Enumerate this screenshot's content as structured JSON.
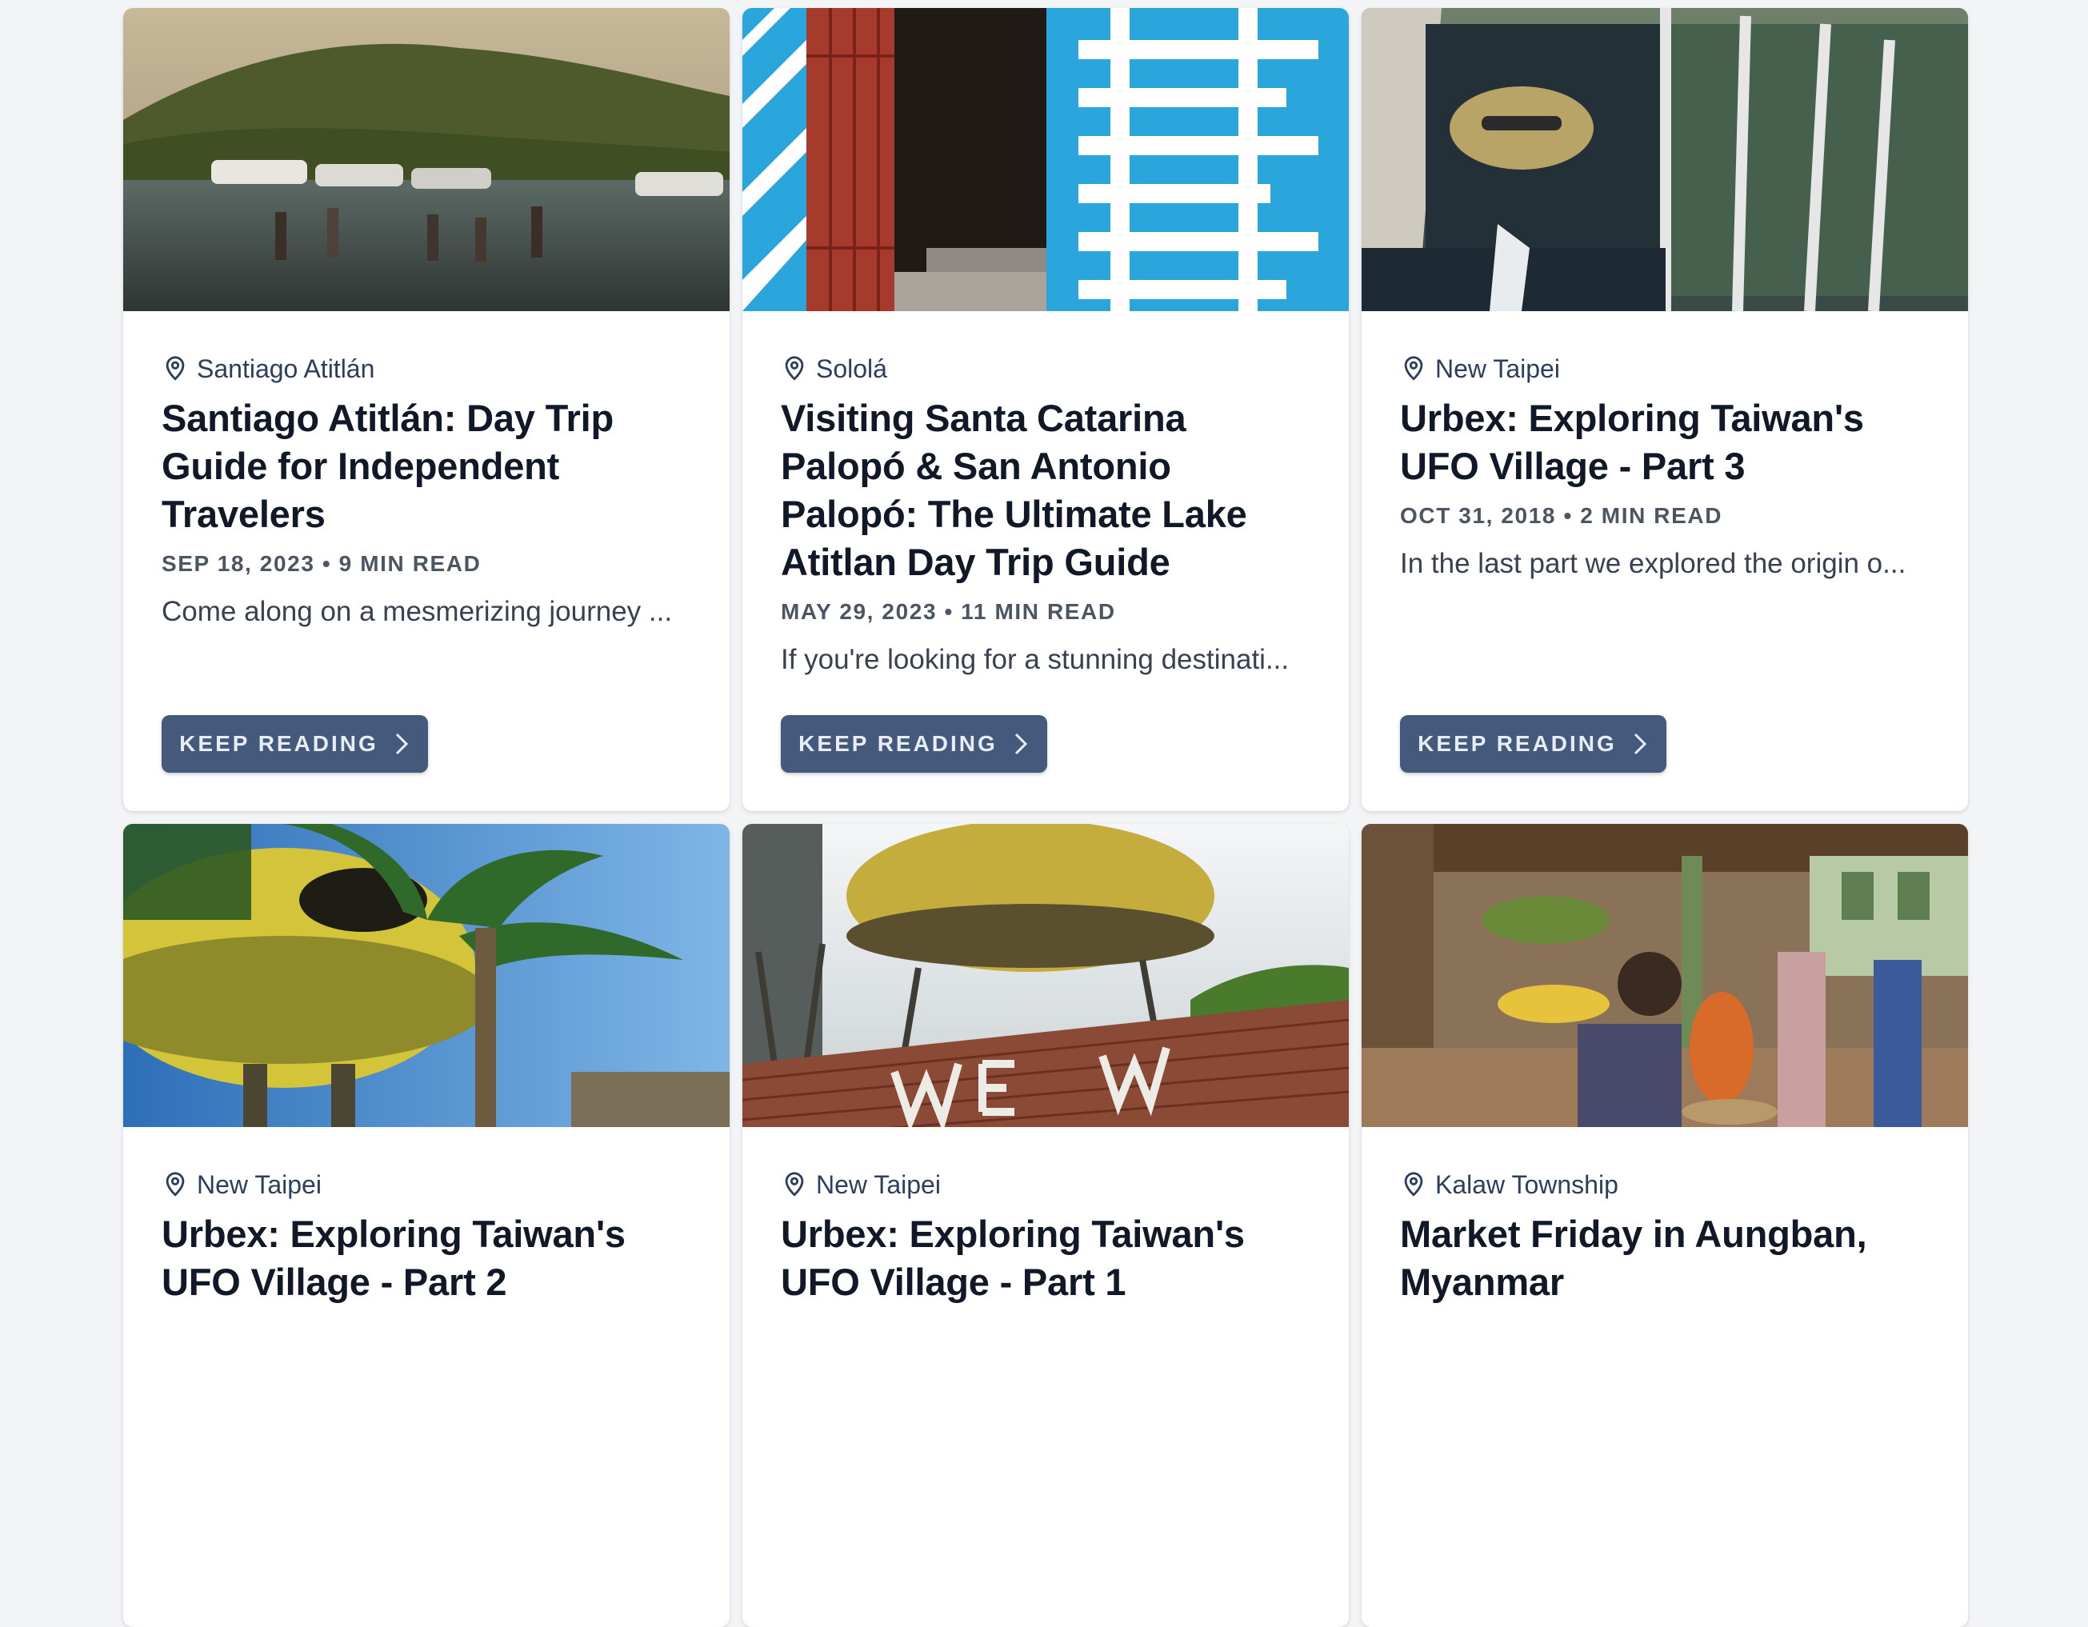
{
  "button_label": "KEEP READING",
  "posts": [
    {
      "location": "Santiago Atitlán",
      "title": "Santiago Atitlán: Day Trip Guide for Independent Travelers",
      "meta": "SEP 18, 2023 • 9 MIN READ",
      "excerpt": "Come along on a mesmerizing journey ..."
    },
    {
      "location": "Sololá",
      "title": "Visiting Santa Catarina Palopó & San Antonio Palopó: The Ultimate Lake Atitlan Day Trip Guide",
      "meta": "MAY 29, 2023 • 11 MIN READ",
      "excerpt": "If you're looking for a stunning destinati..."
    },
    {
      "location": "New Taipei",
      "title": "Urbex: Exploring Taiwan's UFO Village - Part 3",
      "meta": "OCT 31, 2018 • 2 MIN READ",
      "excerpt": "In the last part we explored the origin o..."
    },
    {
      "location": "New Taipei",
      "title": "Urbex: Exploring Taiwan's UFO Village - Part 2"
    },
    {
      "location": "New Taipei",
      "title": "Urbex: Exploring Taiwan's UFO Village - Part 1"
    },
    {
      "location": "Kalaw Township",
      "title": "Market Friday in Aungban, Myanmar"
    }
  ],
  "icons": {
    "location": "map-pin-icon",
    "button": "chevron-right-icon"
  },
  "colors": {
    "page_bg": "#f3f4f6",
    "button_bg": "#44597b",
    "title": "#111827"
  }
}
